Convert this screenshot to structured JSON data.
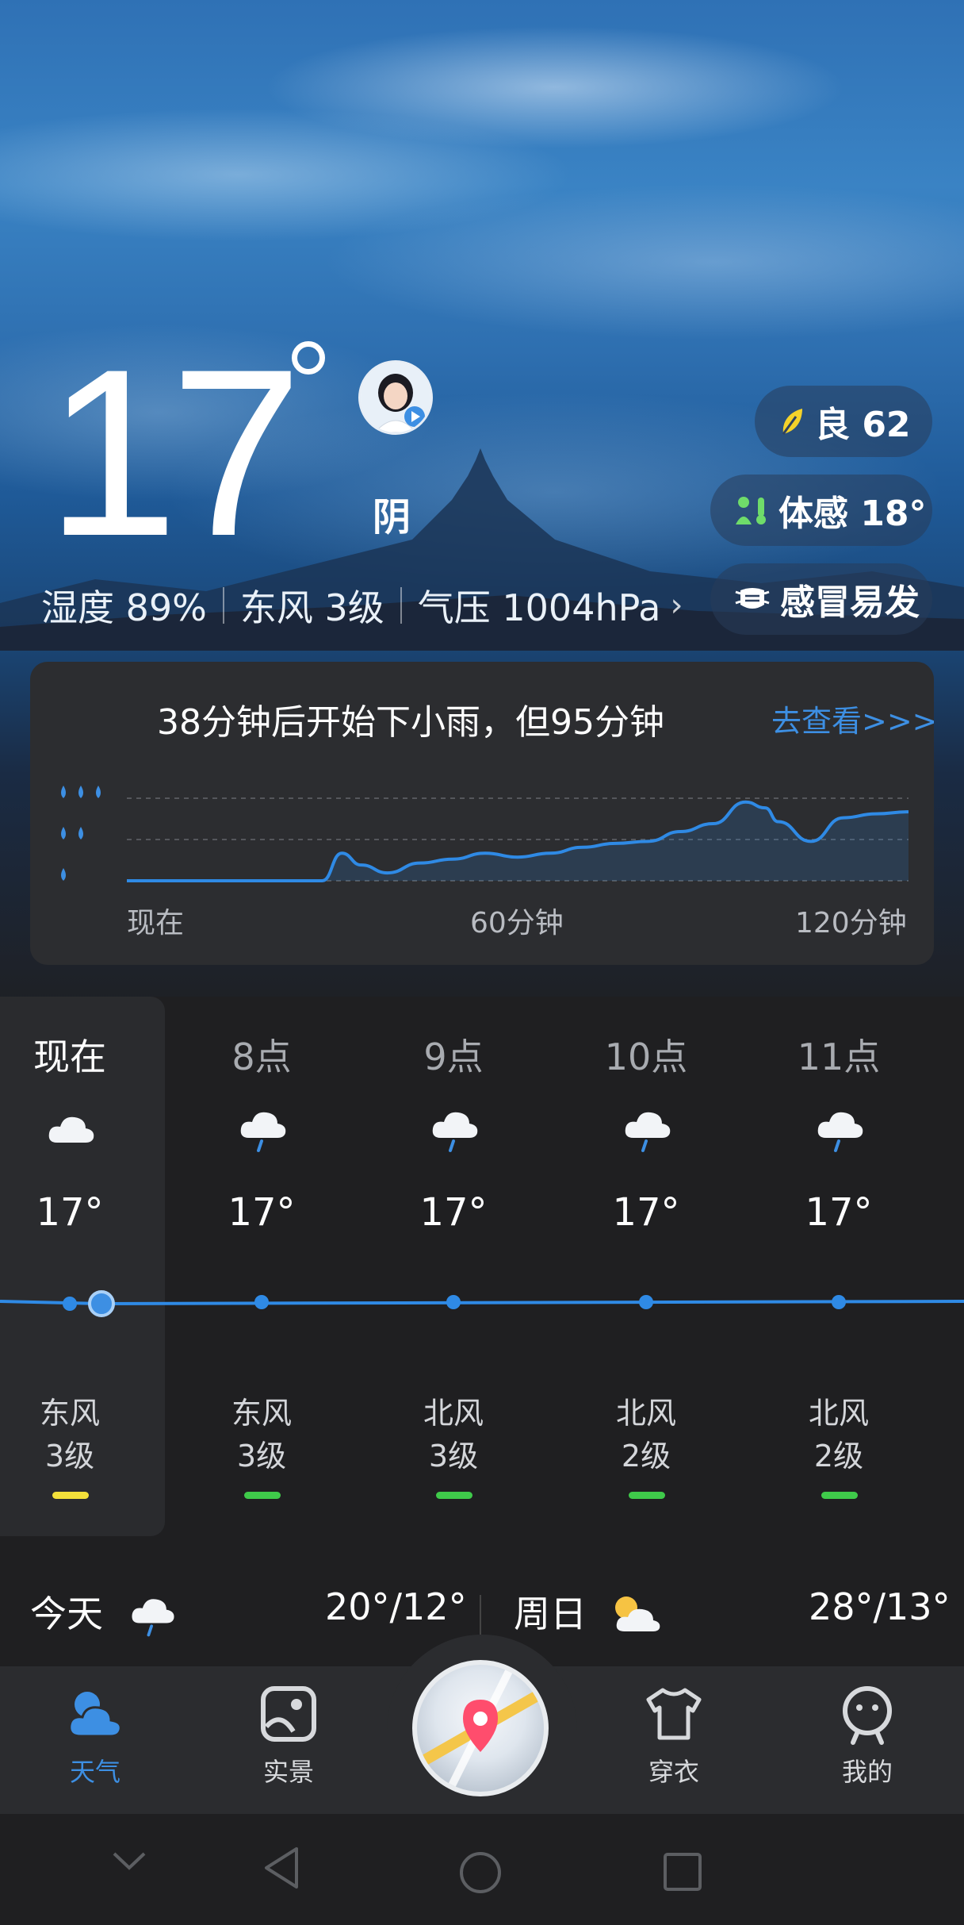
{
  "current": {
    "temperature": "17",
    "condition": "阴",
    "humidity": "湿度 89%",
    "wind": "东风 3级",
    "pressure": "气压 1004hPa",
    "more": "›",
    "aqi_label": "良 62",
    "feels_like": "体感 18°",
    "health_tip": "感冒易发"
  },
  "rain": {
    "title": "38分钟后开始下小雨，但95分钟",
    "link": "去查看>>>",
    "axis": [
      "现在",
      "60分钟",
      "120分钟"
    ],
    "chart_data": {
      "type": "line",
      "x": [
        0,
        10,
        20,
        30,
        33,
        36,
        40,
        45,
        50,
        55,
        60,
        65,
        70,
        75,
        80,
        85,
        90,
        95,
        98,
        100,
        105,
        110,
        115,
        120
      ],
      "values": [
        0,
        0,
        0,
        0,
        0.7,
        0.4,
        0.2,
        0.45,
        0.55,
        0.7,
        0.6,
        0.7,
        0.85,
        0.95,
        1.0,
        1.25,
        1.45,
        2.0,
        1.85,
        1.5,
        1.0,
        1.6,
        1.7,
        1.75
      ],
      "xlabel": "",
      "ylabel": ""
    }
  },
  "hourly": [
    {
      "time": "现在",
      "temp": "17°",
      "icon": "cloudy-icon",
      "wind_dir": "东风",
      "wind_level": "3级",
      "color": "#f3e03a"
    },
    {
      "time": "8点",
      "temp": "17°",
      "icon": "light-rain-icon",
      "wind_dir": "东风",
      "wind_level": "3级",
      "color": "#3fca4a"
    },
    {
      "time": "9点",
      "temp": "17°",
      "icon": "light-rain-icon",
      "wind_dir": "北风",
      "wind_level": "3级",
      "color": "#3fca4a"
    },
    {
      "time": "10点",
      "temp": "17°",
      "icon": "light-rain-icon",
      "wind_dir": "北风",
      "wind_level": "2级",
      "color": "#3fca4a"
    },
    {
      "time": "11点",
      "temp": "17°",
      "icon": "light-rain-icon",
      "wind_dir": "北风",
      "wind_level": "2级",
      "color": "#3fca4a"
    }
  ],
  "daily": [
    {
      "label": "今天",
      "range": "20°/12°",
      "icon": "light-rain-icon"
    },
    {
      "label": "周日",
      "range": "28°/13°",
      "icon": "partly-cloudy-icon"
    }
  ],
  "nav": {
    "weather": "天气",
    "scene": "实景",
    "clothing": "穿衣",
    "mine": "我的"
  },
  "colors": {
    "accent": "#3d8fe3",
    "rain_line": "#2f8ae5"
  }
}
